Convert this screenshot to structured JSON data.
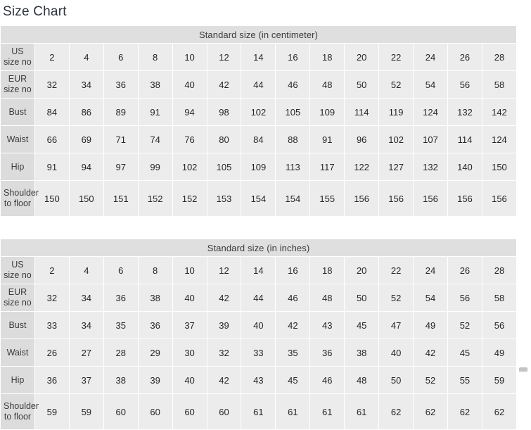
{
  "page": {
    "title": "Size Chart"
  },
  "tables": [
    {
      "id": "centimeter-table",
      "banner": "Standard size (in centimeter)",
      "rows": [
        {
          "label": "US size no",
          "values": [
            "2",
            "4",
            "6",
            "8",
            "10",
            "12",
            "14",
            "16",
            "18",
            "20",
            "22",
            "24",
            "26",
            "28"
          ]
        },
        {
          "label": "EUR size no",
          "values": [
            "32",
            "34",
            "36",
            "38",
            "40",
            "42",
            "44",
            "46",
            "48",
            "50",
            "52",
            "54",
            "56",
            "58"
          ]
        },
        {
          "label": "Bust",
          "values": [
            "84",
            "86",
            "89",
            "91",
            "94",
            "98",
            "102",
            "105",
            "109",
            "114",
            "119",
            "124",
            "132",
            "142"
          ]
        },
        {
          "label": "Waist",
          "values": [
            "66",
            "69",
            "71",
            "74",
            "76",
            "80",
            "84",
            "88",
            "91",
            "96",
            "102",
            "107",
            "114",
            "124"
          ]
        },
        {
          "label": "Hip",
          "values": [
            "91",
            "94",
            "97",
            "99",
            "102",
            "105",
            "109",
            "113",
            "117",
            "122",
            "127",
            "132",
            "140",
            "150"
          ]
        },
        {
          "label": "Shoulder to floor",
          "values": [
            "150",
            "150",
            "151",
            "152",
            "152",
            "153",
            "154",
            "154",
            "155",
            "156",
            "156",
            "156",
            "156",
            "156"
          ]
        }
      ]
    },
    {
      "id": "inches-table",
      "banner": "Standard size (in inches)",
      "rows": [
        {
          "label": "US size no",
          "values": [
            "2",
            "4",
            "6",
            "8",
            "10",
            "12",
            "14",
            "16",
            "18",
            "20",
            "22",
            "24",
            "26",
            "28"
          ]
        },
        {
          "label": "EUR size no",
          "values": [
            "32",
            "34",
            "36",
            "38",
            "40",
            "42",
            "44",
            "46",
            "48",
            "50",
            "52",
            "54",
            "56",
            "58"
          ]
        },
        {
          "label": "Bust",
          "values": [
            "33",
            "34",
            "35",
            "36",
            "37",
            "39",
            "40",
            "42",
            "43",
            "45",
            "47",
            "49",
            "52",
            "56"
          ]
        },
        {
          "label": "Waist",
          "values": [
            "26",
            "27",
            "28",
            "29",
            "30",
            "32",
            "33",
            "35",
            "36",
            "38",
            "40",
            "42",
            "45",
            "49"
          ]
        },
        {
          "label": "Hip",
          "values": [
            "36",
            "37",
            "38",
            "39",
            "40",
            "42",
            "43",
            "45",
            "46",
            "48",
            "50",
            "52",
            "55",
            "59"
          ]
        },
        {
          "label": "Shoulder to floor",
          "values": [
            "59",
            "59",
            "60",
            "60",
            "60",
            "60",
            "61",
            "61",
            "61",
            "61",
            "62",
            "62",
            "62",
            "62"
          ]
        }
      ]
    }
  ],
  "colors": {
    "background": "#ffffff",
    "banner_bg": "#dfdfdf",
    "label_bg": "#dcdcdc",
    "cell_bg": "#ececec",
    "title_text": "#2d3340",
    "cell_text": "#262626"
  }
}
